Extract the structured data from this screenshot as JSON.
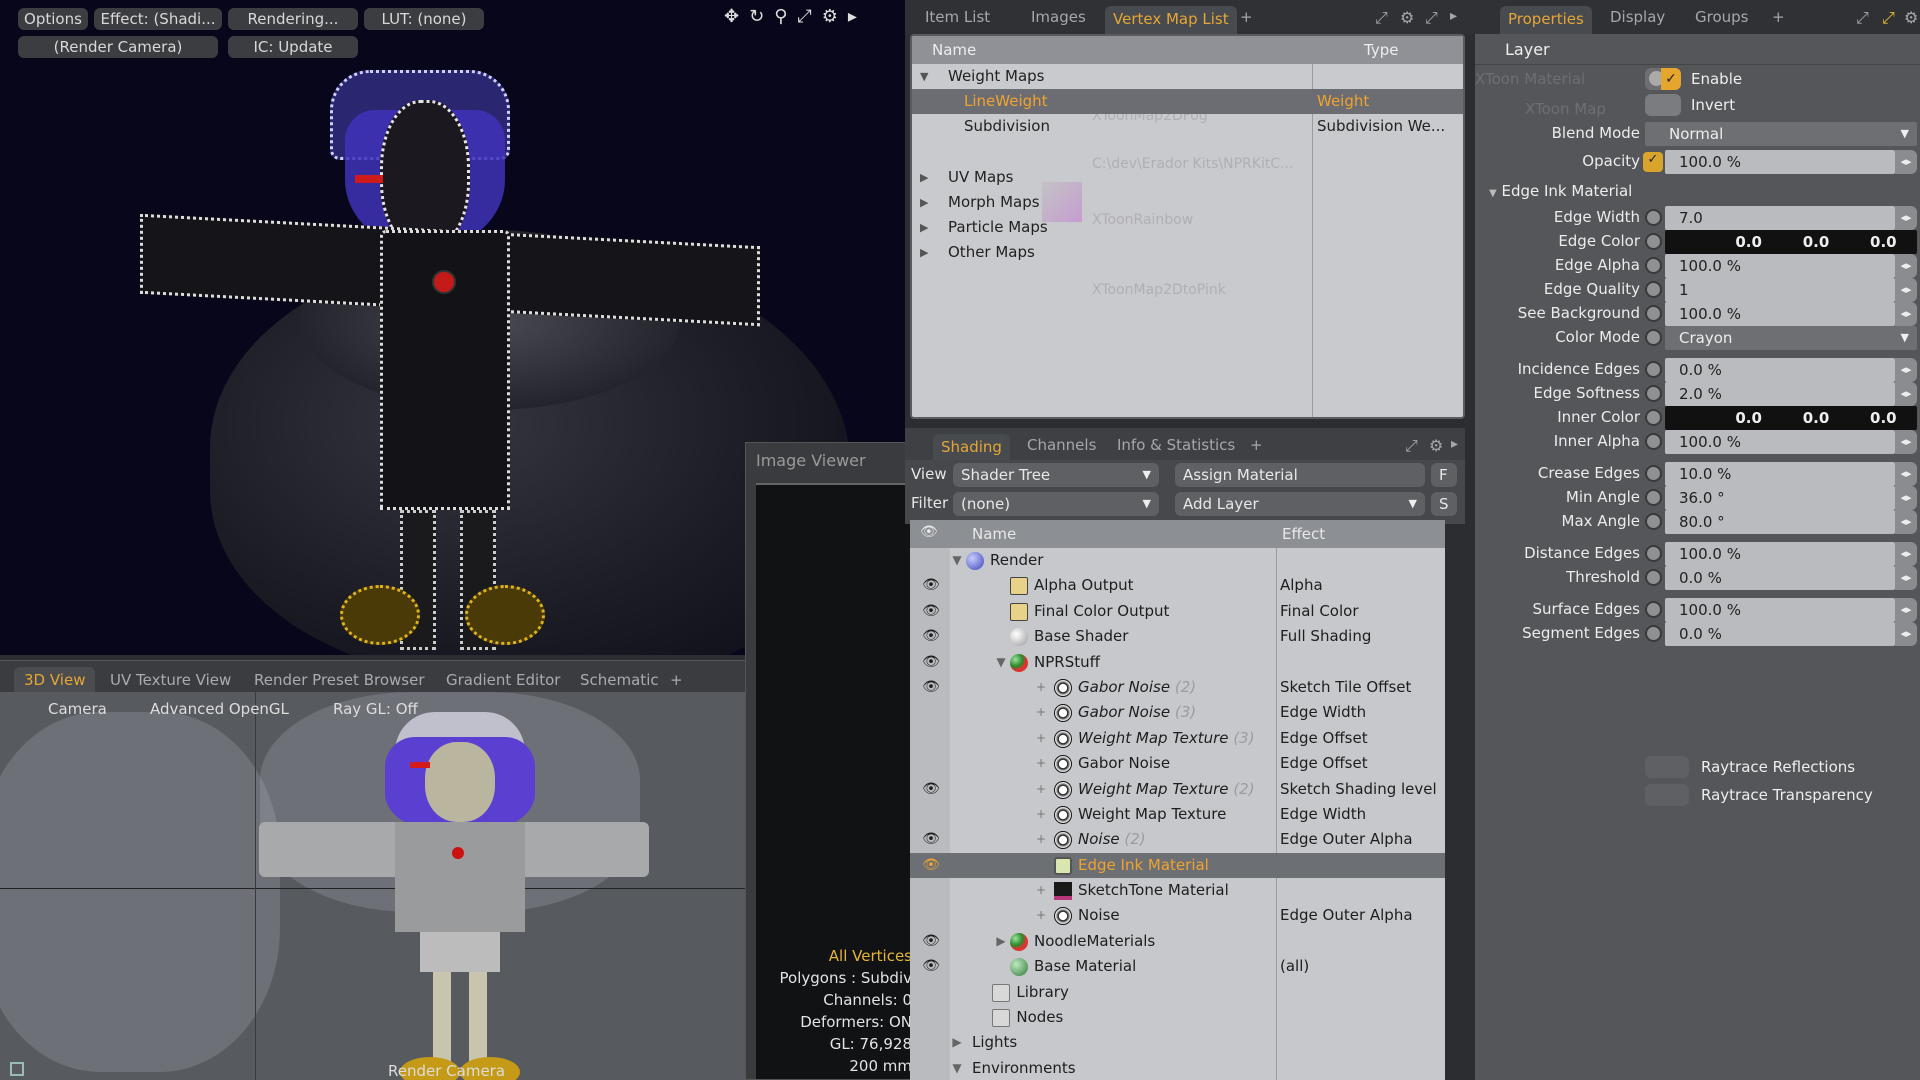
{
  "render_view": {
    "toolbar": {
      "options": "Options",
      "effect": "Effect: (Shadi...",
      "rendering": "Rendering...",
      "lut": "LUT: (none)",
      "camera": "(Render Camera)",
      "ic_update": "IC: Update"
    },
    "icons": [
      "move-icon",
      "rotate-icon",
      "zoom-icon",
      "maximize-icon",
      "gear-icon",
      "expand-arrow-icon"
    ]
  },
  "top_tabs": {
    "items": [
      "Item List",
      "Images",
      "Vertex Map List"
    ],
    "active": "Vertex Map List",
    "add_label": "+"
  },
  "vertex_map_list": {
    "columns": [
      "Name",
      "Type"
    ],
    "groups": [
      {
        "label": "Weight Maps",
        "expanded": true,
        "children": [
          {
            "name": "LineWeight",
            "type": "Weight",
            "selected": true
          },
          {
            "name": "Subdivision",
            "type": "Subdivision We...",
            "selected": false
          }
        ]
      },
      {
        "label": "UV Maps",
        "expanded": false
      },
      {
        "label": "Morph Maps",
        "expanded": false
      },
      {
        "label": "Particle Maps",
        "expanded": false
      },
      {
        "label": "Other Maps",
        "expanded": false
      }
    ]
  },
  "shading": {
    "tabs": [
      "Shading",
      "Channels",
      "Info & Statistics"
    ],
    "active_tab": "Shading",
    "add_label": "+",
    "view_label": "View",
    "view_value": "Shader Tree",
    "assign_material": "Assign Material",
    "f_button": "F",
    "filter_label": "Filter",
    "filter_value": "(none)",
    "add_layer": "Add Layer",
    "s_button": "S",
    "columns": [
      "Name",
      "Effect"
    ],
    "rows": [
      {
        "name": "Render",
        "effect": "",
        "eye": false,
        "indent": 0,
        "icon": "render-sphere",
        "italic": false
      },
      {
        "name": "Alpha Output",
        "effect": "Alpha",
        "eye": true,
        "indent": 1,
        "icon": "output",
        "italic": false
      },
      {
        "name": "Final Color Output",
        "effect": "Final Color",
        "eye": true,
        "indent": 1,
        "icon": "output",
        "italic": false
      },
      {
        "name": "Base Shader",
        "effect": "Full Shading",
        "eye": true,
        "indent": 1,
        "icon": "shader",
        "italic": false
      },
      {
        "name": "NPRStuff",
        "effect": "",
        "eye": true,
        "indent": 1,
        "icon": "group",
        "italic": false
      },
      {
        "name": "Gabor Noise",
        "suffix": "(2)",
        "effect": "Sketch Tile Offset",
        "eye": true,
        "indent": 2,
        "icon": "texture",
        "italic": true
      },
      {
        "name": "Gabor Noise",
        "suffix": "(3)",
        "effect": "Edge Width",
        "eye": false,
        "indent": 2,
        "icon": "texture",
        "italic": true
      },
      {
        "name": "Weight Map Texture",
        "suffix": "(3)",
        "effect": "Edge Offset",
        "eye": false,
        "indent": 2,
        "icon": "texture",
        "italic": true
      },
      {
        "name": "Gabor Noise",
        "effect": "Edge Offset",
        "eye": false,
        "indent": 2,
        "icon": "texture",
        "italic": false
      },
      {
        "name": "Weight Map Texture",
        "suffix": "(2)",
        "effect": "Sketch Shading level",
        "eye": true,
        "indent": 2,
        "icon": "texture",
        "italic": true
      },
      {
        "name": "Weight Map Texture",
        "effect": "Edge Width",
        "eye": false,
        "indent": 2,
        "icon": "texture",
        "italic": false
      },
      {
        "name": "Noise",
        "suffix": "(2)",
        "effect": "Edge Outer Alpha",
        "eye": true,
        "indent": 2,
        "icon": "texture",
        "italic": true
      },
      {
        "name": "Edge Ink Material",
        "effect": "",
        "eye": true,
        "indent": 2,
        "icon": "edge-ink",
        "italic": false,
        "selected": true
      },
      {
        "name": "SketchTone Material",
        "effect": "",
        "eye": false,
        "indent": 2,
        "icon": "sketchtone",
        "italic": false
      },
      {
        "name": "Noise",
        "effect": "Edge Outer Alpha",
        "eye": false,
        "indent": 2,
        "icon": "texture",
        "italic": false
      },
      {
        "name": "NoodleMaterials",
        "effect": "",
        "eye": true,
        "indent": 1,
        "icon": "group",
        "italic": false
      },
      {
        "name": "Base Material",
        "effect": "(all)",
        "eye": true,
        "indent": 1,
        "icon": "material",
        "italic": false
      },
      {
        "name": "Library",
        "effect": "",
        "eye": false,
        "indent": 0.6,
        "icon": "folder",
        "italic": false
      },
      {
        "name": "Nodes",
        "effect": "",
        "eye": false,
        "indent": 0.6,
        "icon": "folder",
        "italic": false
      },
      {
        "name": "Lights",
        "effect": "",
        "eye": false,
        "indent": 0,
        "icon": "none",
        "italic": false
      },
      {
        "name": "Environments",
        "effect": "",
        "eye": false,
        "indent": 0,
        "icon": "none",
        "italic": false
      }
    ]
  },
  "image_viewer": {
    "title": "Image Viewer"
  },
  "view3d": {
    "tabs": [
      "3D View",
      "UV Texture View",
      "Render Preset Browser",
      "Gradient Editor",
      "Schematic"
    ],
    "active_tab": "3D View",
    "add_label": "+",
    "toolbar": {
      "camera": "Camera",
      "opengl": "Advanced OpenGL",
      "raygl": "Ray GL: Off"
    },
    "hud": {
      "selection": "All Vertices",
      "polygons": "Polygons : Subdiv",
      "channels": "Channels: 0",
      "deformers": "Deformers: ON",
      "gl": "GL: 76,928",
      "scale": "200 mm"
    },
    "camera_label": "Render Camera"
  },
  "properties": {
    "tabs": [
      "Properties",
      "Display",
      "Groups"
    ],
    "active_tab": "Properties",
    "add_label": "+",
    "layer_title": "Layer",
    "enable_label": "Enable",
    "enable_checked": true,
    "invert_label": "Invert",
    "blend_mode_label": "Blend Mode",
    "blend_mode": "Normal",
    "opacity_label": "Opacity",
    "opacity": "100.0 %",
    "section": "Edge Ink Material",
    "fields": [
      {
        "label": "Edge Width",
        "value": "7.0",
        "kind": "num"
      },
      {
        "label": "Edge Color",
        "values": [
          "0.0",
          "0.0",
          "0.0"
        ],
        "kind": "color"
      },
      {
        "label": "Edge Alpha",
        "value": "100.0 %",
        "kind": "num"
      },
      {
        "label": "Edge Quality",
        "value": "1",
        "kind": "num"
      },
      {
        "label": "See Background",
        "value": "100.0 %",
        "kind": "num"
      },
      {
        "label": "Color Mode",
        "value": "Crayon",
        "kind": "dropdown"
      },
      {
        "label": "Incidence Edges",
        "value": "0.0 %",
        "kind": "num"
      },
      {
        "label": "Edge Softness",
        "value": "2.0 %",
        "kind": "num"
      },
      {
        "label": "Inner Color",
        "values": [
          "0.0",
          "0.0",
          "0.0"
        ],
        "kind": "color"
      },
      {
        "label": "Inner Alpha",
        "value": "100.0 %",
        "kind": "num"
      },
      {
        "label": "Crease Edges",
        "value": "10.0 %",
        "kind": "num"
      },
      {
        "label": "Min Angle",
        "value": "36.0 °",
        "kind": "num"
      },
      {
        "label": "Max Angle",
        "value": "80.0 °",
        "kind": "num"
      },
      {
        "label": "Distance Edges",
        "value": "100.0 %",
        "kind": "num"
      },
      {
        "label": "Threshold",
        "value": "0.0 %",
        "kind": "num"
      },
      {
        "label": "Surface Edges",
        "value": "100.0 %",
        "kind": "num"
      },
      {
        "label": "Segment Edges",
        "value": "0.0 %",
        "kind": "num"
      }
    ],
    "raytrace_reflections": "Raytrace Reflections",
    "raytrace_transparency": "Raytrace Transparency"
  },
  "colors": {
    "accent": "#e6a635",
    "panel_bg": "#545659",
    "list_bg": "#c6c8cc"
  }
}
